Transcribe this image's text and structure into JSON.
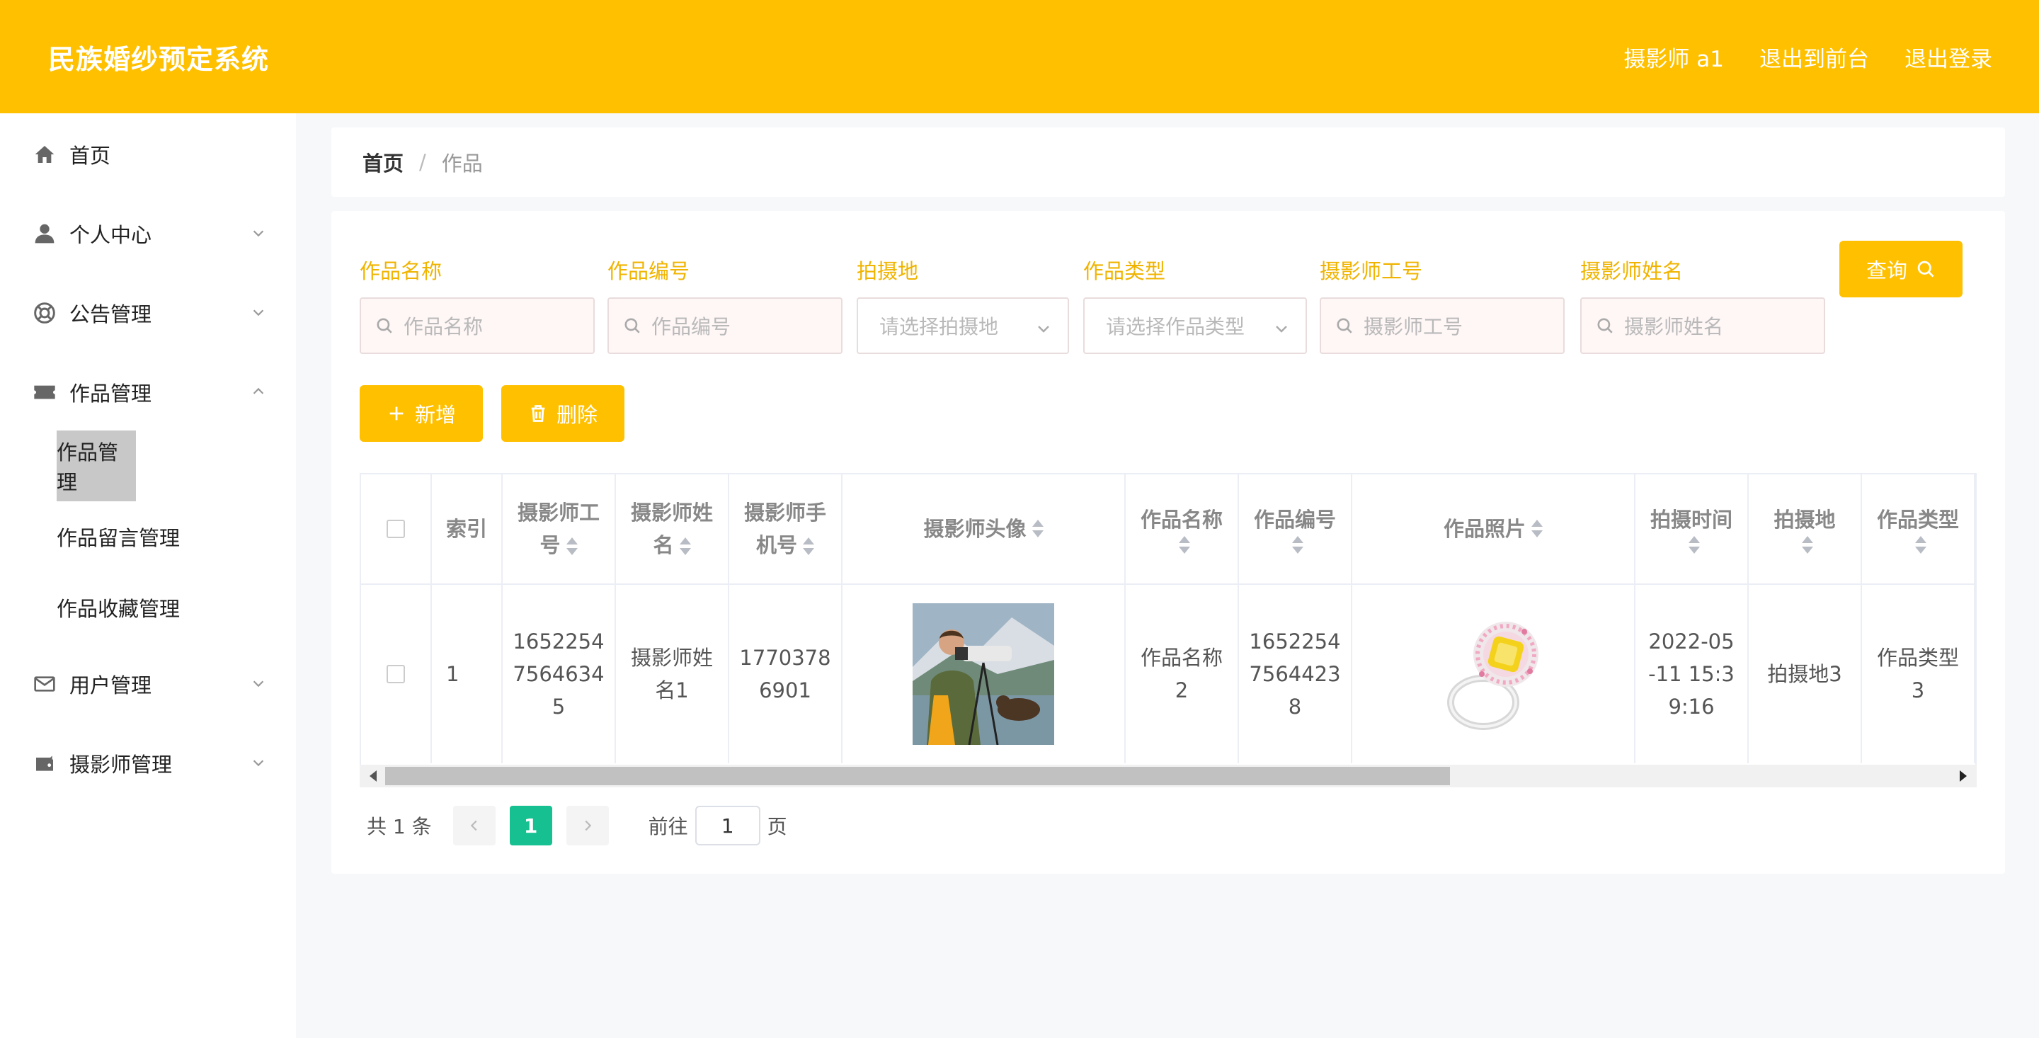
{
  "header": {
    "title": "民族婚纱预定系统",
    "user": "摄影师 a1",
    "to_front": "退出到前台",
    "logout": "退出登录"
  },
  "sidebar": {
    "items": [
      {
        "label": "首页",
        "icon": "home-icon"
      },
      {
        "label": "个人中心",
        "icon": "user-icon"
      },
      {
        "label": "公告管理",
        "icon": "lifebuoy-icon"
      },
      {
        "label": "作品管理",
        "icon": "ticket-icon"
      },
      {
        "label": "用户管理",
        "icon": "mail-icon"
      },
      {
        "label": "摄影师管理",
        "icon": "wallet-icon"
      }
    ],
    "sub_items": [
      "作品管理",
      "作品留言管理",
      "作品收藏管理"
    ]
  },
  "breadcrumb": {
    "home": "首页",
    "sep": "/",
    "current": "作品"
  },
  "filters": [
    {
      "label": "作品名称",
      "placeholder": "作品名称"
    },
    {
      "label": "作品编号",
      "placeholder": "作品编号"
    },
    {
      "label": "拍摄地",
      "placeholder": "请选择拍摄地"
    },
    {
      "label": "作品类型",
      "placeholder": "请选择作品类型"
    },
    {
      "label": "摄影师工号",
      "placeholder": "摄影师工号"
    },
    {
      "label": "摄影师姓名",
      "placeholder": "摄影师姓名"
    }
  ],
  "buttons": {
    "search": "查询",
    "add": "新增",
    "delete": "删除"
  },
  "table": {
    "headers": {
      "index": "索引",
      "photographer_id_1": "摄影师工",
      "photographer_id_2": "号",
      "photographer_name_1": "摄影师姓",
      "photographer_name_2": "名",
      "photographer_phone_1": "摄影师手",
      "photographer_phone_2": "机号",
      "photographer_avatar": "摄影师头像",
      "work_name": "作品名称",
      "work_no": "作品编号",
      "work_photo": "作品照片",
      "shoot_time": "拍摄时间",
      "shoot_place": "拍摄地",
      "work_type": "作品类型"
    },
    "rows": [
      {
        "index": "1",
        "photographer_id_l1": "1652254",
        "photographer_id_l2": "7564634",
        "photographer_id_l3": "5",
        "photographer_name_l1": "摄影师姓",
        "photographer_name_l2": "名1",
        "phone_l1": "1770378",
        "phone_l2": "6901",
        "work_name_l1": "作品名称",
        "work_name_l2": "2",
        "work_no_l1": "1652254",
        "work_no_l2": "7564423",
        "work_no_l3": "8",
        "time_l1": "2022-05",
        "time_l2": "-11 15:3",
        "time_l3": "9:16",
        "place": "拍摄地3",
        "type_l1": "作品类型",
        "type_l2": "3"
      }
    ]
  },
  "pagination": {
    "total": "共 1 条",
    "current": "1",
    "goto": "前往",
    "page_input": "1",
    "page_unit": "页"
  },
  "colors": {
    "primary": "#ffc000",
    "page_active": "#16c090"
  }
}
